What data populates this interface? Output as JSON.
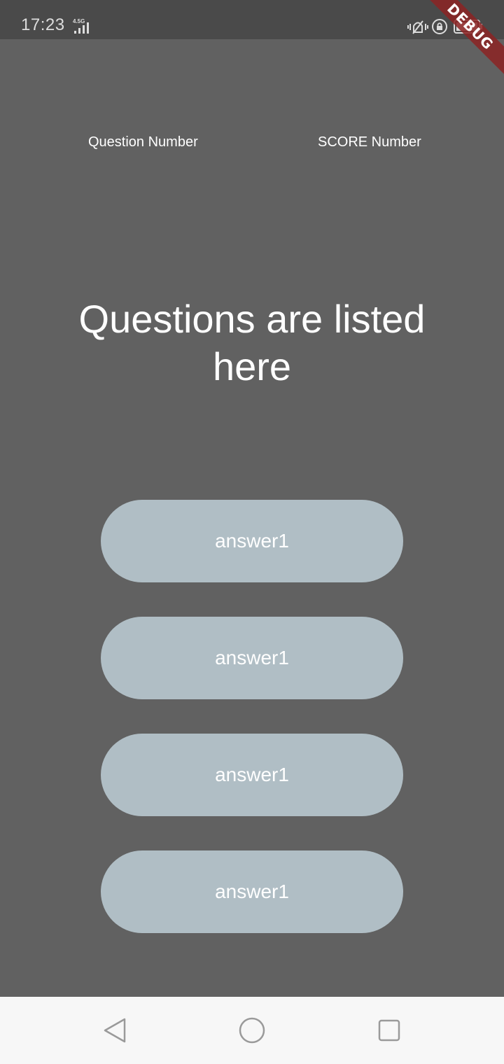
{
  "status_bar": {
    "time": "17:23",
    "network_type": "4.5G",
    "icons": [
      "signal-icon",
      "vibrate-icon",
      "rotation-lock-icon",
      "battery-icon"
    ]
  },
  "debug_banner": {
    "label": "DEBUG",
    "color": "#8c2323"
  },
  "header": {
    "question_label": "Question Number",
    "score_label": "SCORE Number"
  },
  "question": {
    "text": "Questions are listed here"
  },
  "answers": [
    {
      "label": "answer1"
    },
    {
      "label": "answer1"
    },
    {
      "label": "answer1"
    },
    {
      "label": "answer1"
    }
  ],
  "nav_bar": {
    "icons": [
      "back-icon",
      "home-icon",
      "recents-icon"
    ]
  },
  "colors": {
    "background": "#616161",
    "answer_button": "#b0bec5",
    "text": "#ffffff",
    "nav_bar": "#f7f7f7"
  }
}
